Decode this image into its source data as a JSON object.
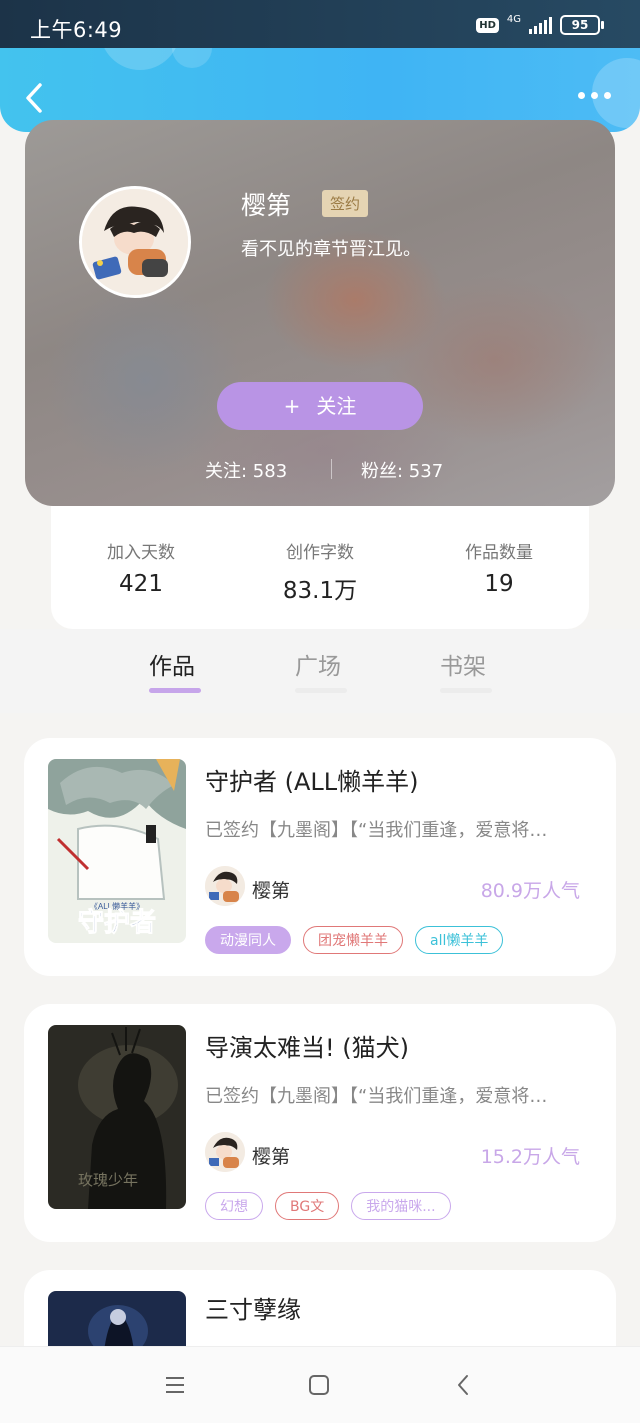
{
  "status_bar": {
    "time": "上午6:49",
    "hd": "HD",
    "network": "4G",
    "battery": "95"
  },
  "profile": {
    "name": "樱第",
    "badge": "签约",
    "motto": "看不见的章节晋江见。",
    "follow_button": {
      "plus": "+",
      "label": "关注"
    },
    "following_text": "关注: 583",
    "fans_text": "粉丝: 537"
  },
  "summary": [
    {
      "label": "加入天数",
      "value": "421"
    },
    {
      "label": "创作字数",
      "value": "83.1万"
    },
    {
      "label": "作品数量",
      "value": "19"
    }
  ],
  "tabs": [
    {
      "label": "作品",
      "active": true
    },
    {
      "label": "广场",
      "active": false
    },
    {
      "label": "书架",
      "active": false
    }
  ],
  "books": [
    {
      "title": "守护者 (ALL懒羊羊)",
      "description": "已签约【九墨阁】【“当我们重逢，爱意将…",
      "author": "樱第",
      "popularity": "80.9万人气",
      "cover_text": "守护者",
      "cover_subtext": "《ALL懒羊羊》",
      "tags": [
        {
          "label": "动漫同人",
          "style": "filled",
          "color": "#c9a8ec"
        },
        {
          "label": "团宠懒羊羊",
          "style": "outline",
          "color": "#e07878"
        },
        {
          "label": "all懒羊羊",
          "style": "outline",
          "color": "#3cc1d8"
        }
      ]
    },
    {
      "title": "导演太难当! (猫犬)",
      "description": "已签约【九墨阁】【“当我们重逢，爱意将…",
      "author": "樱第",
      "popularity": "15.2万人气",
      "cover_text": "玫瑰少年",
      "tags": [
        {
          "label": "幻想",
          "style": "outline",
          "color": "#c9a8ec"
        },
        {
          "label": "BG文",
          "style": "outline",
          "color": "#e07878"
        },
        {
          "label": "我的猫咪...",
          "style": "outline",
          "color": "#c9a8ec"
        }
      ]
    },
    {
      "title": "三寸孽缘"
    }
  ],
  "colors": {
    "accent_purple": "#b994e5",
    "header_blue": "#3fb4f4",
    "popularity": "#c8a7e8"
  },
  "icons": {
    "back": "chevron-left-icon",
    "more": "more-dots-icon",
    "nav_menu": "menu-lines-icon",
    "nav_home": "square-home-icon",
    "nav_back": "triangle-back-icon"
  }
}
